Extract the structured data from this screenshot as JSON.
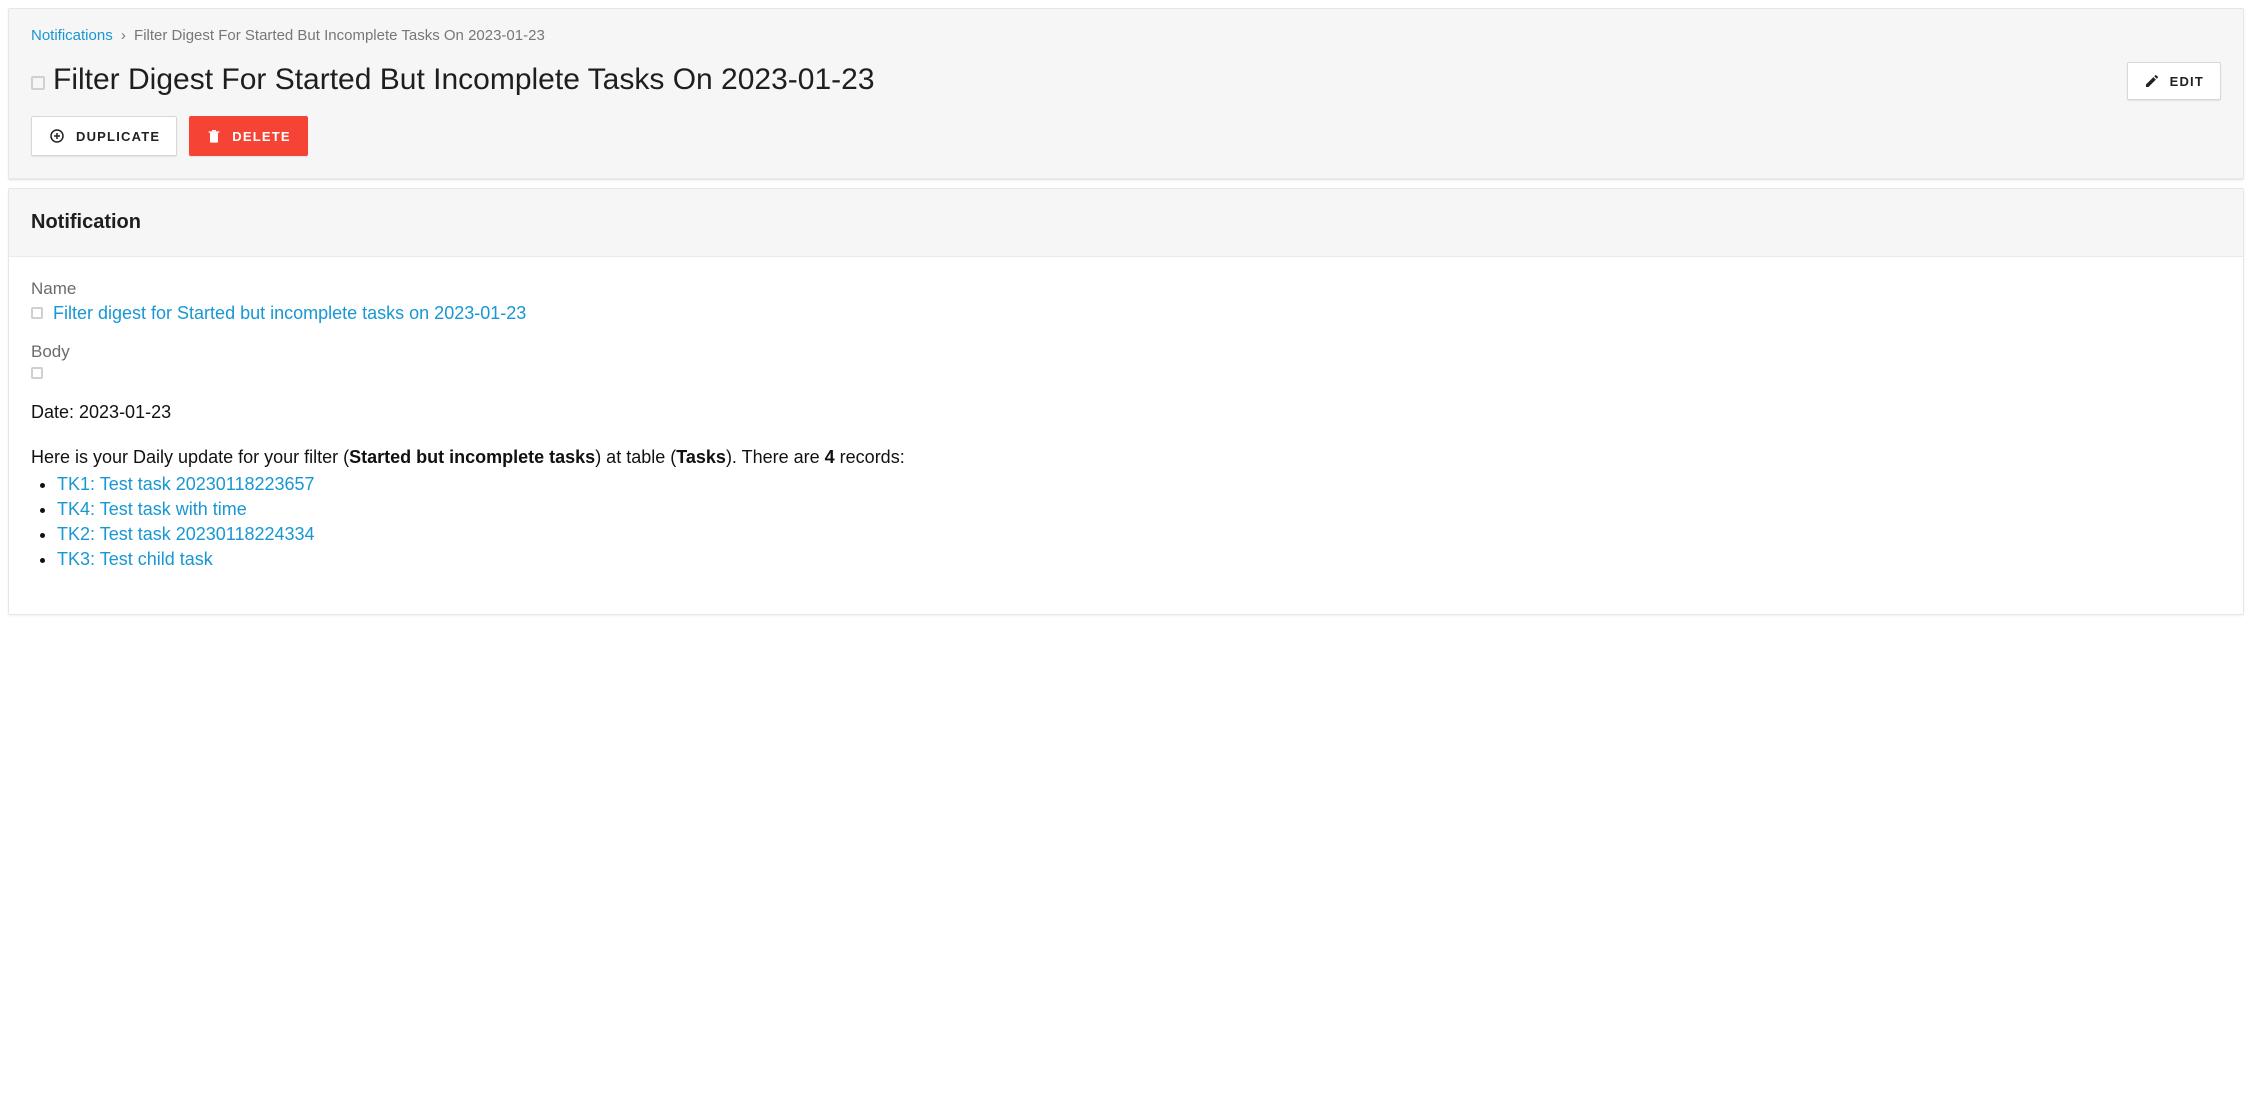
{
  "breadcrumb": {
    "root": "Notifications",
    "current": "Filter Digest For Started But Incomplete Tasks On 2023-01-23"
  },
  "title": "Filter Digest For Started But Incomplete Tasks On 2023-01-23",
  "buttons": {
    "edit": "EDIT",
    "duplicate": "DUPLICATE",
    "delete": "DELETE"
  },
  "section": {
    "heading": "Notification",
    "name_label": "Name",
    "name_value": "Filter digest for Started but incomplete tasks on 2023-01-23",
    "body_label": "Body"
  },
  "body": {
    "date_line": "Date: 2023-01-23",
    "intro_prefix": "Here is your Daily update for your filter (",
    "filter_name": "Started but incomplete tasks",
    "intro_mid": ") at table (",
    "table_name": "Tasks",
    "intro_after_table": "). There are ",
    "record_count": "4",
    "intro_suffix": " records:",
    "items": [
      "TK1: Test task 20230118223657",
      "TK4: Test task with time",
      "TK2: Test task 20230118224334",
      "TK3: Test child task"
    ]
  }
}
